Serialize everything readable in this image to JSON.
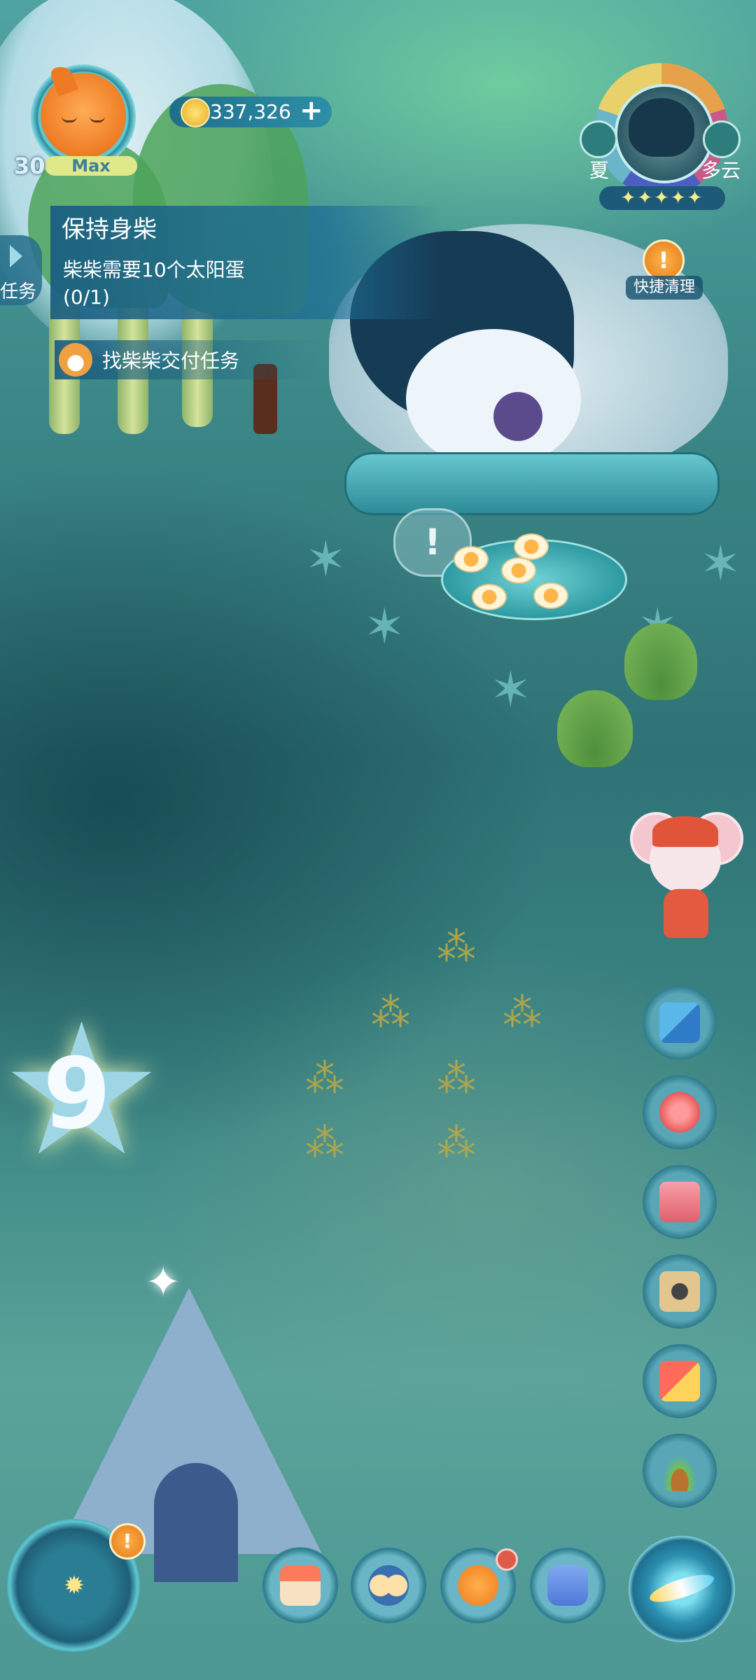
{
  "player": {
    "level": "30",
    "level_badge": "Max"
  },
  "currency": {
    "coins": "337,326",
    "add_label": "+"
  },
  "task": {
    "tab_label": "任务",
    "title": "保持身柴",
    "description": "柴柴需要10个太阳蛋",
    "progress": "(0/1)",
    "deliver_label": "找柴柴交付任务"
  },
  "weather": {
    "season": "夏",
    "condition": "多云",
    "stars": "✦✦✦✦✦",
    "quick_action_label": "快捷清理"
  },
  "world": {
    "star_counter": "9"
  },
  "side_menu": [
    {
      "icon": "grid-moon-icon"
    },
    {
      "icon": "megaphone-icon"
    },
    {
      "icon": "flower-book-icon"
    },
    {
      "icon": "camera-icon"
    },
    {
      "icon": "hammer-icon"
    },
    {
      "icon": "sprout-icon"
    }
  ],
  "bottom_nav": [
    {
      "icon": "shop-icon"
    },
    {
      "icon": "friends-icon"
    },
    {
      "icon": "pet-cat-icon"
    },
    {
      "icon": "backpack-icon"
    }
  ],
  "colors": {
    "accent": "#2d8fa6",
    "alert": "#f0962a",
    "panel": "#185c80"
  }
}
